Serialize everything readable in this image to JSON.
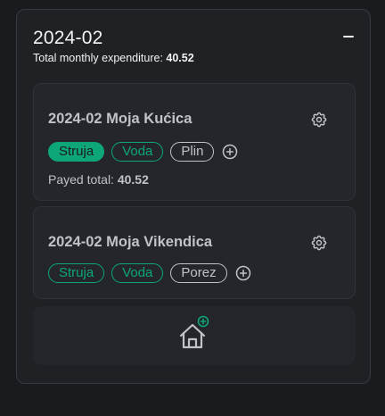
{
  "month": {
    "title": "2024-02",
    "total_label": "Total monthly expenditure:",
    "total_value": "40.52"
  },
  "houses": [
    {
      "title": "2024-02 Moja Kućica",
      "bills": [
        "Struja",
        "Voda",
        "Plin"
      ],
      "payed_label": "Payed total:",
      "payed_value": "40.52"
    },
    {
      "title": "2024-02 Moja Vikendica",
      "bills": [
        "Struja",
        "Voda",
        "Porez"
      ]
    }
  ],
  "icons": {
    "collapse": "minus-icon",
    "settings": "gear-icon",
    "add_bill": "plus-circle-icon",
    "add_house": "home-plus-icon"
  },
  "colors": {
    "accent": "#0ca678",
    "background": "#1a1b1e",
    "card": "#25262b",
    "muted_text": "#c1c2c5"
  }
}
